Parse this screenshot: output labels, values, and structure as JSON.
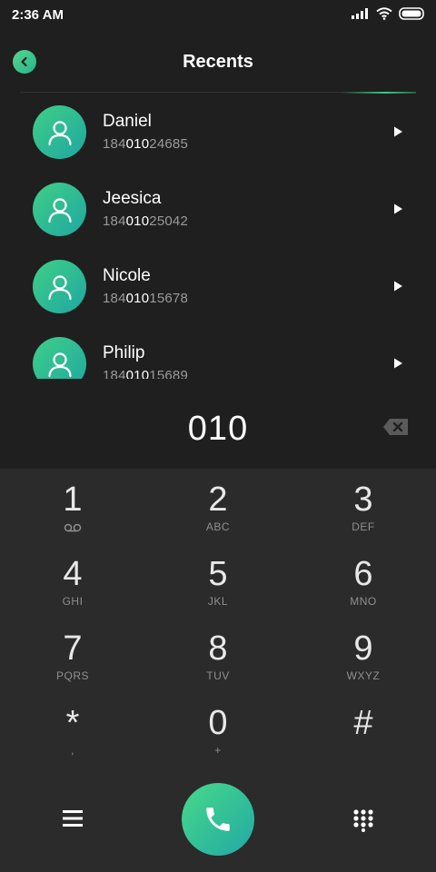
{
  "status_bar": {
    "time": "2:36 AM",
    "icons": [
      "signal-icon",
      "wifi-icon",
      "battery-icon"
    ]
  },
  "header": {
    "title": "Recents",
    "back_icon": "chevron-left-icon"
  },
  "recents": [
    {
      "name": "Daniel",
      "number_prefix": "184",
      "number_match": "010",
      "number_suffix": "24685"
    },
    {
      "name": "Jeesica",
      "number_prefix": "184",
      "number_match": "010",
      "number_suffix": "25042"
    },
    {
      "name": "Nicole",
      "number_prefix": "184",
      "number_match": "010",
      "number_suffix": "15678"
    },
    {
      "name": "Philip",
      "number_prefix": "184",
      "number_match": "010",
      "number_suffix": "15689"
    }
  ],
  "dialer": {
    "entered_number": "010"
  },
  "keypad": {
    "keys": [
      {
        "digit": "1",
        "letters": ""
      },
      {
        "digit": "2",
        "letters": "ABC"
      },
      {
        "digit": "3",
        "letters": "DEF"
      },
      {
        "digit": "4",
        "letters": "GHI"
      },
      {
        "digit": "5",
        "letters": "JKL"
      },
      {
        "digit": "6",
        "letters": "MNO"
      },
      {
        "digit": "7",
        "letters": "PQRS"
      },
      {
        "digit": "8",
        "letters": "TUV"
      },
      {
        "digit": "9",
        "letters": "WXYZ"
      },
      {
        "digit": "*",
        "letters": ","
      },
      {
        "digit": "0",
        "letters": "+"
      },
      {
        "digit": "#",
        "letters": ""
      }
    ]
  },
  "colors": {
    "accent_start": "#48d98a",
    "accent_end": "#21a9a4",
    "background": "#1f1f1f",
    "keypad_background": "#2b2b2b"
  }
}
